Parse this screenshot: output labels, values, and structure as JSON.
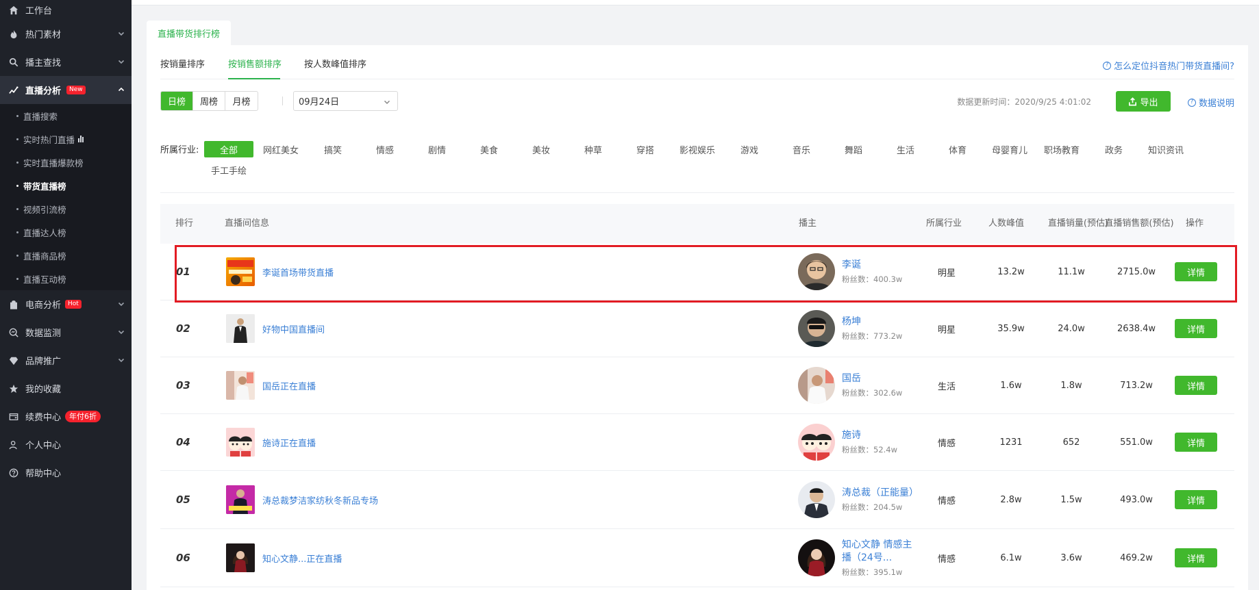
{
  "sidebar": {
    "workbench": "工作台",
    "hot_material": "热门素材",
    "anchor_search": "播主查找",
    "live_analysis": "直播分析",
    "live_analysis_badge": "New",
    "sub_items": [
      "直播搜索",
      "实时热门直播",
      "实时直播爆款榜",
      "带货直播榜",
      "视频引流榜",
      "直播达人榜",
      "直播商品榜",
      "直播互动榜"
    ],
    "ecommerce": "电商分析",
    "ecommerce_badge": "Hot",
    "monitor": "数据监测",
    "brand": "品牌推广",
    "favorites": "我的收藏",
    "renew": "续费中心",
    "renew_badge": "年付6折",
    "personal": "个人中心",
    "help": "帮助中心"
  },
  "panel_tab": "直播带货排行榜",
  "sort_tabs": [
    "按销量排序",
    "按销售额排序",
    "按人数峰值排序"
  ],
  "help_link": "怎么定位抖音热门带货直播间?",
  "period_tabs": [
    "日榜",
    "周榜",
    "月榜"
  ],
  "date_value": "09月24日",
  "update_time": "数据更新时间：2020/9/25 4:01:02",
  "export_label": "导出",
  "data_note": "数据说明",
  "industry_label": "所属行业:",
  "industries": [
    "全部",
    "网红美女",
    "搞笑",
    "情感",
    "剧情",
    "美食",
    "美妆",
    "种草",
    "穿搭",
    "影视娱乐",
    "游戏",
    "音乐",
    "舞蹈",
    "生活",
    "体育",
    "母婴育儿",
    "职场教育",
    "政务",
    "知识资讯",
    "手工手绘"
  ],
  "table_headers": {
    "rank": "排行",
    "room": "直播间信息",
    "anchor": "播主",
    "industry": "所属行业",
    "peak": "人数峰值",
    "sales": "直播销量(预估)",
    "amount": "直播销售额(预估)",
    "action": "操作"
  },
  "fans_prefix": "粉丝数：",
  "detail_label": "详情",
  "rows": [
    {
      "rank": "01",
      "room": "李诞首场带货直播",
      "anchor": "李诞",
      "fans": "400.3w",
      "industry": "明星",
      "peak": "13.2w",
      "sales": "11.1w",
      "amount": "2715.0w"
    },
    {
      "rank": "02",
      "room": "好物中国直播间",
      "anchor": "杨坤",
      "fans": "773.2w",
      "industry": "明星",
      "peak": "35.9w",
      "sales": "24.0w",
      "amount": "2638.4w"
    },
    {
      "rank": "03",
      "room": "国岳正在直播",
      "anchor": "国岳",
      "fans": "302.6w",
      "industry": "生活",
      "peak": "1.6w",
      "sales": "1.8w",
      "amount": "713.2w"
    },
    {
      "rank": "04",
      "room": "施诗正在直播",
      "anchor": "施诗",
      "fans": "52.4w",
      "industry": "情感",
      "peak": "1231",
      "sales": "652",
      "amount": "551.0w"
    },
    {
      "rank": "05",
      "room": "涛总裁梦洁家纺秋冬新品专场",
      "anchor": "涛总裁（正能量）",
      "fans": "204.5w",
      "industry": "情感",
      "peak": "2.8w",
      "sales": "1.5w",
      "amount": "493.0w"
    },
    {
      "rank": "06",
      "room": "知心文静...正在直播",
      "anchor": "知心文静 情感主播（24号...",
      "fans": "395.1w",
      "industry": "情感",
      "peak": "6.1w",
      "sales": "3.6w",
      "amount": "469.2w"
    }
  ]
}
